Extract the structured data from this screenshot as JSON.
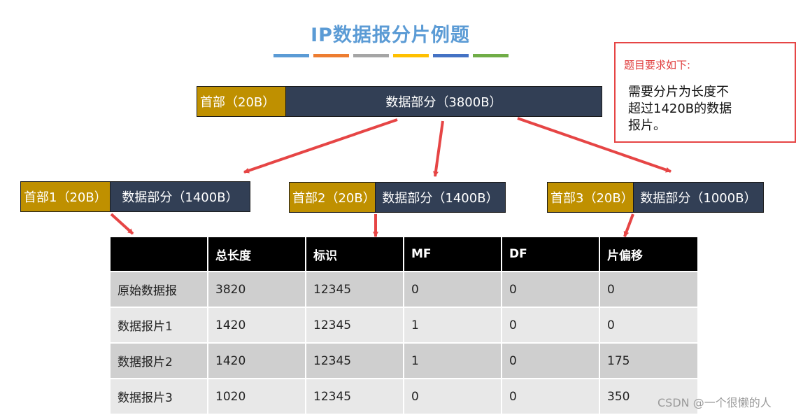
{
  "title": "IP数据报分片例题",
  "title_bar_colors": [
    "#5b9bd5",
    "#ed7d31",
    "#a5a5a5",
    "#ffc000",
    "#4472c4",
    "#70ad47"
  ],
  "colors": {
    "header_gold": "#bf9000",
    "data_navy": "#323f55",
    "arrow_red": "#e64545"
  },
  "original": {
    "header": "首部（20B）",
    "data": "数据部分（3800B）"
  },
  "fragments": [
    {
      "header": "首部1（20B）",
      "data": "数据部分（1400B）"
    },
    {
      "header": "首部2（20B）",
      "data": "数据部分（1400B）"
    },
    {
      "header": "首部3（20B）",
      "data": "数据部分（1000B）"
    }
  ],
  "note": {
    "title": "题目要求如下:",
    "body": "需要分片为长度不超过1420B的数据报片。"
  },
  "table": {
    "headers": [
      "",
      "总长度",
      "标识",
      "MF",
      "DF",
      "片偏移"
    ],
    "rows": [
      [
        "原始数据报",
        "3820",
        "12345",
        "0",
        "0",
        "0"
      ],
      [
        "数据报片1",
        "1420",
        "12345",
        "1",
        "0",
        "0"
      ],
      [
        "数据报片2",
        "1420",
        "12345",
        "1",
        "0",
        "175"
      ],
      [
        "数据报片3",
        "1020",
        "12345",
        "0",
        "0",
        "350"
      ]
    ]
  },
  "watermark": "CSDN @一个很懒的人"
}
